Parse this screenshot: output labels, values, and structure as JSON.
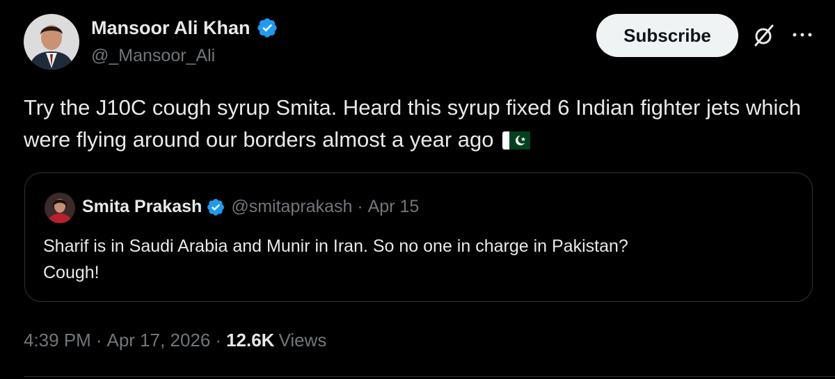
{
  "author": {
    "name": "Mansoor Ali Khan",
    "handle": "@_Mansoor_Ali"
  },
  "actions": {
    "subscribe_label": "Subscribe",
    "grok_icon": "grok-icon",
    "more_icon": "more-icon"
  },
  "tweet": {
    "text": "Try the J10C cough syrup Smita. Heard this syrup fixed 6 Indian fighter jets which were flying around our borders almost a year ago",
    "flag_icon": "pakistan-flag-icon"
  },
  "quote": {
    "name": "Smita Prakash",
    "handle": "@smitaprakash",
    "separator": " · ",
    "date": "Apr 15",
    "line1": "Sharif is in Saudi Arabia and Munir in Iran. So no one in charge in Pakistan?",
    "line2": "Cough!"
  },
  "footer": {
    "time": "4:39 PM",
    "separator": "·",
    "date": "Apr 17, 2026",
    "views_count": "12.6K",
    "views_label": "Views"
  },
  "colors": {
    "background": "#000000",
    "text": "#e7e9ea",
    "muted": "#71767b",
    "verified": "#1d9bf0",
    "border": "#2f3336"
  }
}
